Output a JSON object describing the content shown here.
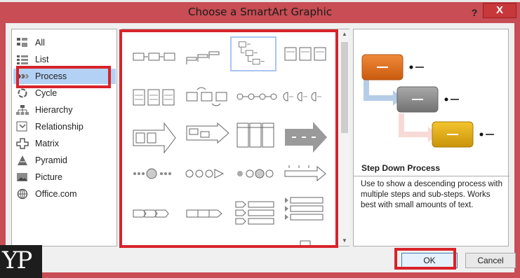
{
  "window": {
    "title": "Choose a SmartArt Graphic",
    "help_label": "?",
    "close_label": "X"
  },
  "categories": [
    {
      "label": "All",
      "icon": "all-icon"
    },
    {
      "label": "List",
      "icon": "list-icon"
    },
    {
      "label": "Process",
      "icon": "process-icon",
      "selected": true
    },
    {
      "label": "Cycle",
      "icon": "cycle-icon"
    },
    {
      "label": "Hierarchy",
      "icon": "hierarchy-icon"
    },
    {
      "label": "Relationship",
      "icon": "relationship-icon"
    },
    {
      "label": "Matrix",
      "icon": "matrix-icon"
    },
    {
      "label": "Pyramid",
      "icon": "pyramid-icon"
    },
    {
      "label": "Picture",
      "icon": "picture-icon"
    },
    {
      "label": "Office.com",
      "icon": "office-com-icon"
    }
  ],
  "preview": {
    "title": "Step Down Process",
    "description": "Use to show a descending process with multiple steps and sub-steps. Works best with small amounts of text.",
    "colors": [
      "#e2731e",
      "#8c8c8c",
      "#e8b10d"
    ]
  },
  "buttons": {
    "ok": "OK",
    "cancel": "Cancel"
  },
  "watermark": {
    "text": "YP"
  },
  "colors": {
    "highlight": "#d8232a",
    "selection": "#b3d1f5",
    "title_bar": "#c84d54"
  }
}
